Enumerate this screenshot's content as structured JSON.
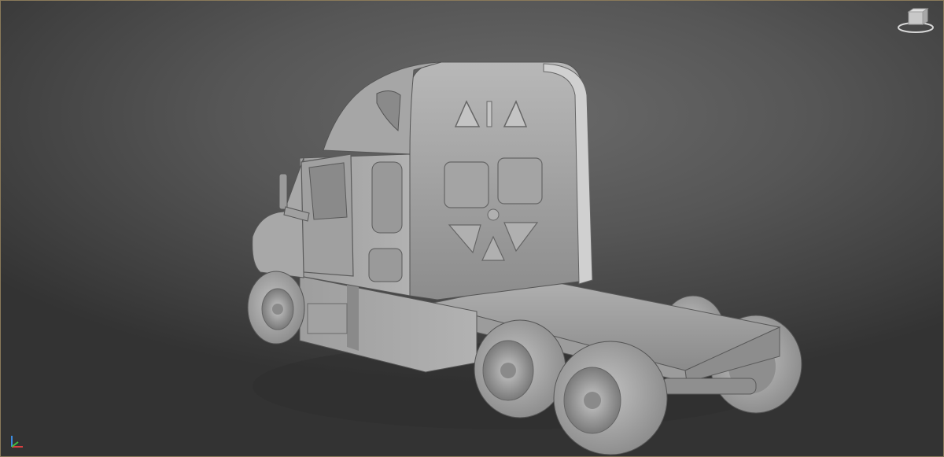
{
  "viewport": {
    "background_top": "#6a6a6a",
    "background_bottom": "#333333",
    "border_color": "#8a7a5a"
  },
  "model": {
    "shade_light": "#b4b4b4",
    "shade_mid": "#9a9a9a",
    "shade_dark": "#6e6e6e",
    "outline": "#4a4a4a"
  },
  "viewcube": {
    "icon": "viewcube-icon"
  },
  "axis_tripod": {
    "icon": "axis-tripod-icon"
  }
}
